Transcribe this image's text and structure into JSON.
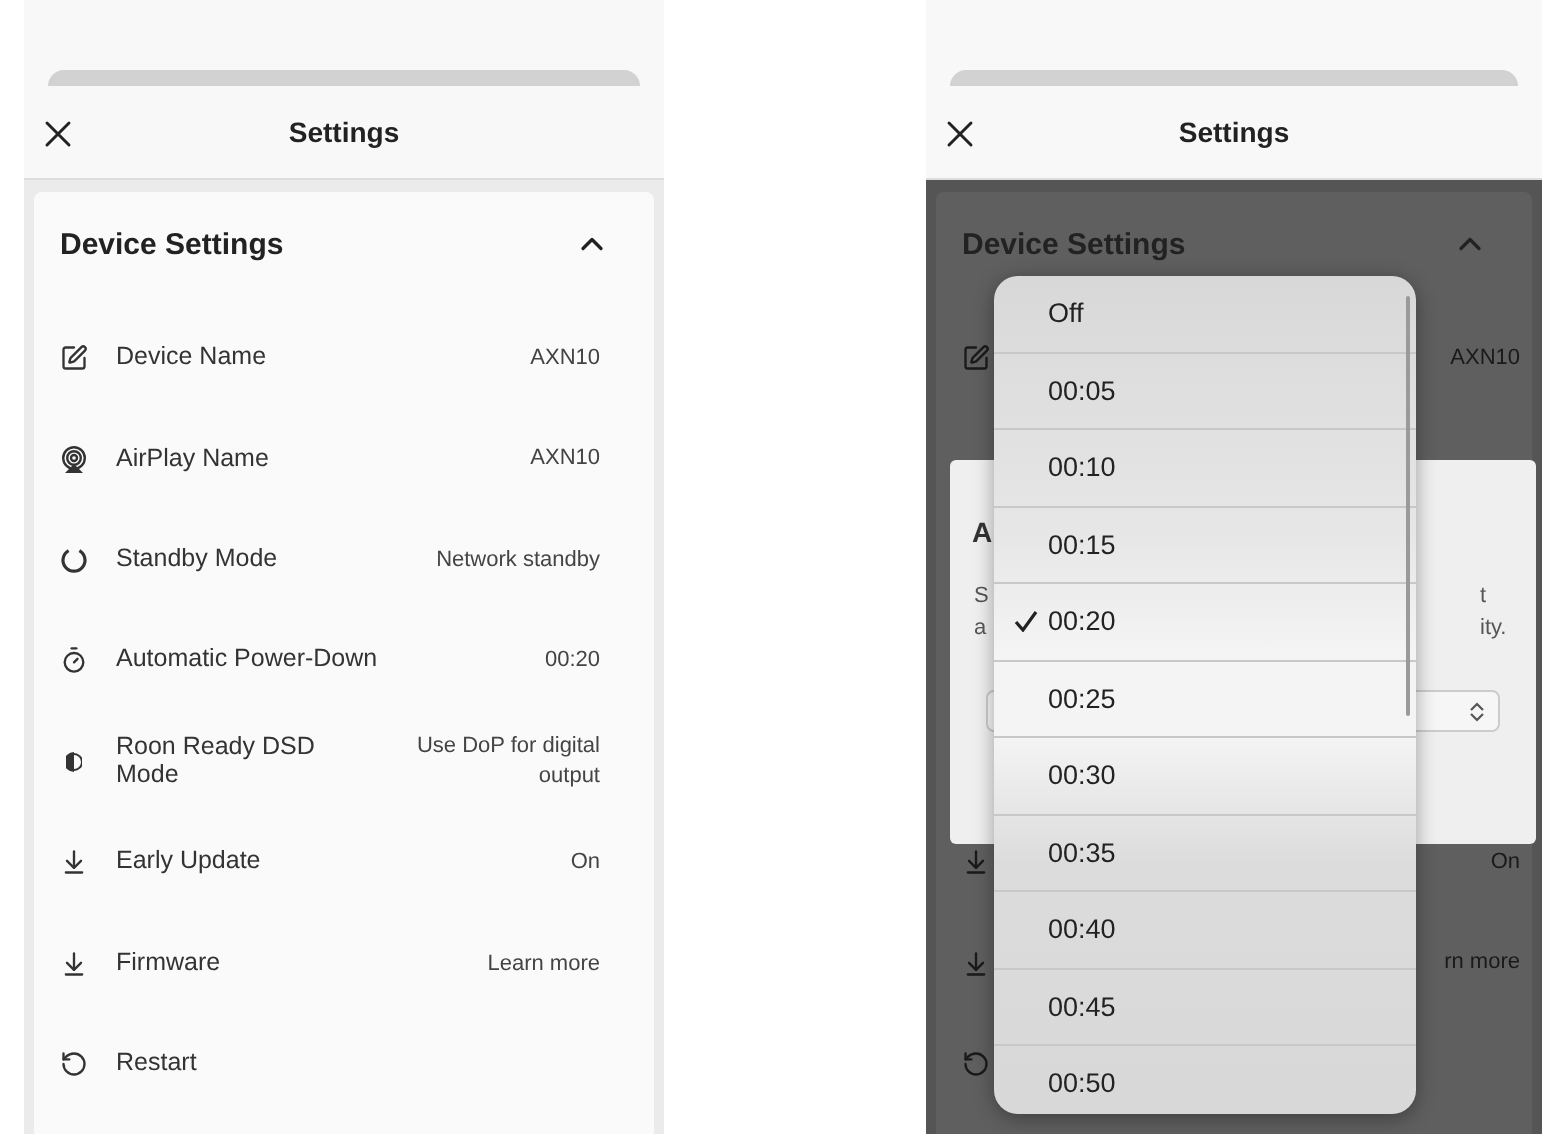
{
  "screens": [
    {
      "header": {
        "title": "Settings"
      },
      "section": {
        "title": "Device Settings",
        "expanded": true
      },
      "rows": [
        {
          "kind": "edit",
          "label": "Device Name",
          "value": "AXN10"
        },
        {
          "kind": "airplay",
          "label": "AirPlay Name",
          "value": "AXN10"
        },
        {
          "kind": "standby",
          "label": "Standby Mode",
          "value": "Network standby"
        },
        {
          "kind": "timer",
          "label": "Automatic Power-Down",
          "value": "00:20"
        },
        {
          "kind": "dsd",
          "label": "Roon Ready DSD Mode",
          "value": "Use DoP for digital output"
        },
        {
          "kind": "download",
          "label": "Early Update",
          "value": "On"
        },
        {
          "kind": "download",
          "label": "Firmware",
          "value": "Learn more"
        },
        {
          "kind": "restart",
          "label": "Restart"
        }
      ]
    },
    {
      "header": {
        "title": "Settings"
      },
      "section": {
        "title": "Device Settings",
        "expanded": true
      },
      "background_rows": [
        {
          "kind": "edit",
          "value": "AXN10"
        },
        {
          "kind": "hidden"
        },
        {
          "kind": "hidden"
        },
        {
          "kind": "hidden"
        },
        {
          "kind": "hidden"
        },
        {
          "kind": "download",
          "value": "On"
        },
        {
          "kind": "download",
          "value": "rn more"
        },
        {
          "kind": "restart"
        }
      ],
      "dialog": {
        "title": "A",
        "text_left": [
          "S",
          "a"
        ],
        "text_right": [
          "t",
          "ity."
        ]
      },
      "picker": {
        "options": [
          {
            "label": "Off",
            "selected": false
          },
          {
            "label": "00:05",
            "selected": false
          },
          {
            "label": "00:10",
            "selected": false
          },
          {
            "label": "00:15",
            "selected": false
          },
          {
            "label": "00:20",
            "selected": true
          },
          {
            "label": "00:25",
            "selected": false
          },
          {
            "label": "00:30",
            "selected": false
          },
          {
            "label": "00:35",
            "selected": false
          },
          {
            "label": "00:40",
            "selected": false
          },
          {
            "label": "00:45",
            "selected": false
          },
          {
            "label": "00:50",
            "selected": false
          }
        ]
      }
    }
  ]
}
